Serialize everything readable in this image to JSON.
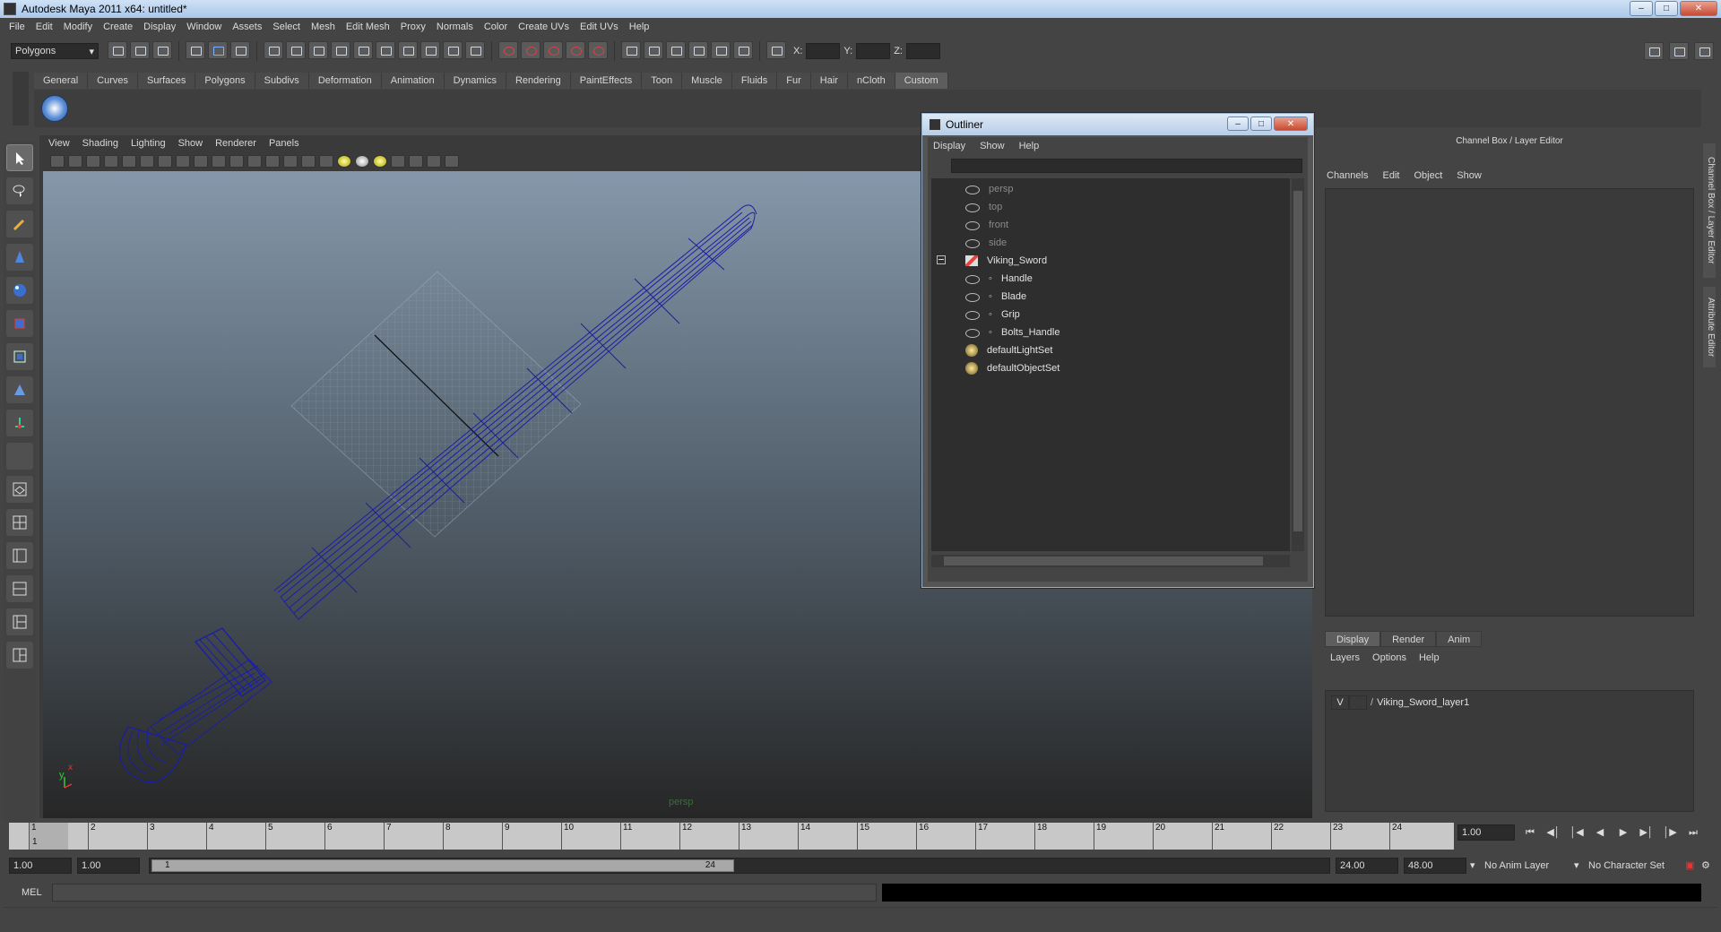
{
  "window": {
    "title": "Autodesk Maya 2011 x64: untitled*"
  },
  "menubar": [
    "File",
    "Edit",
    "Modify",
    "Create",
    "Display",
    "Window",
    "Assets",
    "Select",
    "Mesh",
    "Edit Mesh",
    "Proxy",
    "Normals",
    "Color",
    "Create UVs",
    "Edit UVs",
    "Help"
  ],
  "status": {
    "mode": "Polygons",
    "x_label": "X:",
    "y_label": "Y:",
    "z_label": "Z:"
  },
  "shelf": {
    "tabs": [
      "General",
      "Curves",
      "Surfaces",
      "Polygons",
      "Subdivs",
      "Deformation",
      "Animation",
      "Dynamics",
      "Rendering",
      "PaintEffects",
      "Toon",
      "Muscle",
      "Fluids",
      "Fur",
      "Hair",
      "nCloth",
      "Custom"
    ],
    "active": "Custom"
  },
  "viewport": {
    "menu": [
      "View",
      "Shading",
      "Lighting",
      "Show",
      "Renderer",
      "Panels"
    ],
    "camera": "persp",
    "axis_y": "y",
    "axis_x": "x"
  },
  "outliner": {
    "title": "Outliner",
    "menu": [
      "Display",
      "Show",
      "Help"
    ],
    "items": [
      {
        "label": "persp",
        "dim": true,
        "icon": "camera-icon"
      },
      {
        "label": "top",
        "dim": true,
        "icon": "camera-icon"
      },
      {
        "label": "front",
        "dim": true,
        "icon": "camera-icon"
      },
      {
        "label": "side",
        "dim": true,
        "icon": "camera-icon"
      },
      {
        "label": "Viking_Sword",
        "dim": false,
        "icon": "group-icon"
      },
      {
        "label": "Handle",
        "dim": false,
        "icon": "mesh-icon"
      },
      {
        "label": "Blade",
        "dim": false,
        "icon": "mesh-icon"
      },
      {
        "label": "Grip",
        "dim": false,
        "icon": "mesh-icon"
      },
      {
        "label": "Bolts_Handle",
        "dim": false,
        "icon": "mesh-icon"
      },
      {
        "label": "defaultLightSet",
        "dim": false,
        "icon": "set-icon"
      },
      {
        "label": "defaultObjectSet",
        "dim": false,
        "icon": "set-icon"
      }
    ]
  },
  "channelbox": {
    "header": "Channel Box / Layer Editor",
    "menu": [
      "Channels",
      "Edit",
      "Object",
      "Show"
    ],
    "layer_tabs": [
      "Display",
      "Render",
      "Anim"
    ],
    "layer_menu": [
      "Layers",
      "Options",
      "Help"
    ],
    "layer": {
      "visible": "V",
      "name": "Viking_Sword_layer1"
    },
    "side_tabs": [
      "Channel Box / Layer Editor",
      "Attribute Editor"
    ]
  },
  "timeline": {
    "ticks": [
      "1",
      "2",
      "3",
      "4",
      "5",
      "6",
      "7",
      "8",
      "9",
      "10",
      "11",
      "12",
      "13",
      "14",
      "15",
      "16",
      "17",
      "18",
      "19",
      "20",
      "21",
      "22",
      "23",
      "24"
    ],
    "current_frame": "1",
    "current_field": "1.00"
  },
  "range": {
    "start": "1.00",
    "playback_start": "1.00",
    "thumb_start": "1",
    "thumb_end": "24",
    "playback_end": "24.00",
    "end": "48.00",
    "anim_layer": "No Anim Layer",
    "char_set": "No Character Set"
  },
  "cmd": {
    "label": "MEL"
  }
}
